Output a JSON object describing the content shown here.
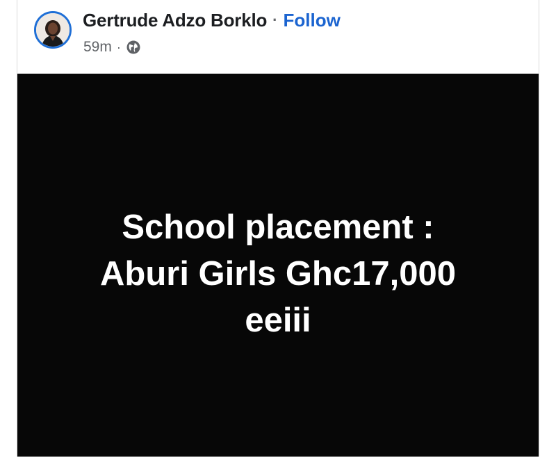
{
  "post": {
    "author": {
      "name": "Gertrude Adzo Borklo",
      "avatar_icon": "profile-photo-avatar"
    },
    "separator": "·",
    "follow_label": "Follow",
    "meta": {
      "timestamp": "59m",
      "separator": "·",
      "audience_icon": "globe-icon"
    },
    "image_text": {
      "line1": "School placement :",
      "line2": "Aburi Girls Ghc17,000",
      "line3": "eeiii"
    }
  },
  "colors": {
    "link": "#1b64d0",
    "avatar_ring": "#1f6fd6",
    "post_background": "#070707",
    "text_primary": "#1c1e21",
    "text_secondary": "#5f6266"
  }
}
